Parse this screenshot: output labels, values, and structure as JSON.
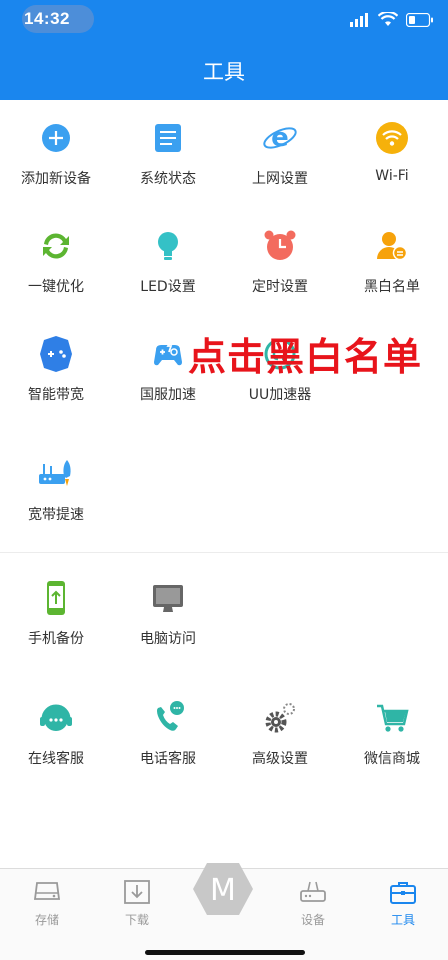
{
  "status": {
    "time": "14:32"
  },
  "header": {
    "title": "工具"
  },
  "grid1": [
    {
      "label": "添加新设备",
      "icon": "add-device-icon"
    },
    {
      "label": "系统状态",
      "icon": "system-status-icon"
    },
    {
      "label": "上网设置",
      "icon": "internet-settings-icon"
    },
    {
      "label": "Wi-Fi",
      "icon": "wifi-icon"
    },
    {
      "label": "一键优化",
      "icon": "optimize-icon"
    },
    {
      "label": "LED设置",
      "icon": "led-icon"
    },
    {
      "label": "定时设置",
      "icon": "alarm-clock-icon"
    },
    {
      "label": "黑白名单",
      "icon": "blacklist-icon"
    },
    {
      "label": "智能带宽",
      "icon": "gamepad-icon"
    },
    {
      "label": "国服加速",
      "icon": "game-accel-icon"
    },
    {
      "label": "UU加速器",
      "icon": "uu-accelerator-icon"
    },
    {
      "label": "宽带提速",
      "icon": "broadband-boost-icon"
    }
  ],
  "grid2": [
    {
      "label": "手机备份",
      "icon": "phone-backup-icon"
    },
    {
      "label": "电脑访问",
      "icon": "computer-access-icon"
    },
    {
      "label": "在线客服",
      "icon": "online-service-icon"
    },
    {
      "label": "电话客服",
      "icon": "phone-service-icon"
    },
    {
      "label": "高级设置",
      "icon": "advanced-settings-icon"
    },
    {
      "label": "微信商城",
      "icon": "shopping-cart-icon"
    }
  ],
  "overlay": {
    "text": "点击黑白名单"
  },
  "tabbar": {
    "items": [
      {
        "label": "存储",
        "icon": "storage-icon"
      },
      {
        "label": "下载",
        "icon": "download-icon"
      },
      {
        "label": "设备",
        "icon": "router-icon"
      },
      {
        "label": "工具",
        "icon": "toolbox-icon"
      }
    ],
    "center_letter": "M"
  },
  "colors": {
    "accent": "#1a86ee",
    "overlay": "#e8141b"
  }
}
